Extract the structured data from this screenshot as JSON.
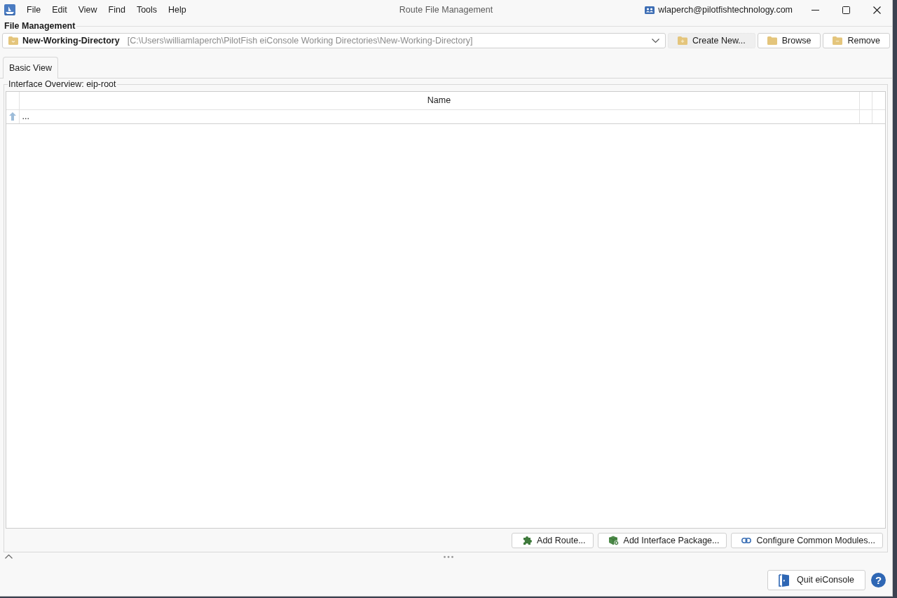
{
  "window": {
    "title": "Route File Management",
    "account": "wlaperch@pilotfishtechnology.com"
  },
  "menu": [
    "File",
    "Edit",
    "View",
    "Find",
    "Tools",
    "Help"
  ],
  "file_management": {
    "title": "File Management",
    "directory": {
      "name": "New-Working-Directory",
      "path": "[C:\\Users\\williamlaperch\\PilotFish eiConsole Working Directories\\New-Working-Directory]"
    },
    "buttons": [
      {
        "label": "Create New...",
        "kind": "create",
        "hovered": true
      },
      {
        "label": "Browse",
        "kind": "browse",
        "hovered": false
      },
      {
        "label": "Remove",
        "kind": "remove",
        "hovered": false
      }
    ]
  },
  "tabs": [
    {
      "label": "Basic View",
      "selected": true
    }
  ],
  "interface_overview": {
    "title": "Interface Overview: eip-root",
    "table": {
      "columns": [
        "Name"
      ],
      "rows": [
        {
          "kind": "parent",
          "name": "..."
        }
      ]
    },
    "buttons": [
      {
        "label": "Add Route...",
        "kind": "route"
      },
      {
        "label": "Add Interface Package...",
        "kind": "package"
      },
      {
        "label": "Configure Common Modules...",
        "kind": "modules"
      }
    ]
  },
  "footer": {
    "quit_button": "Quit eiConsole",
    "help_button": "?"
  }
}
